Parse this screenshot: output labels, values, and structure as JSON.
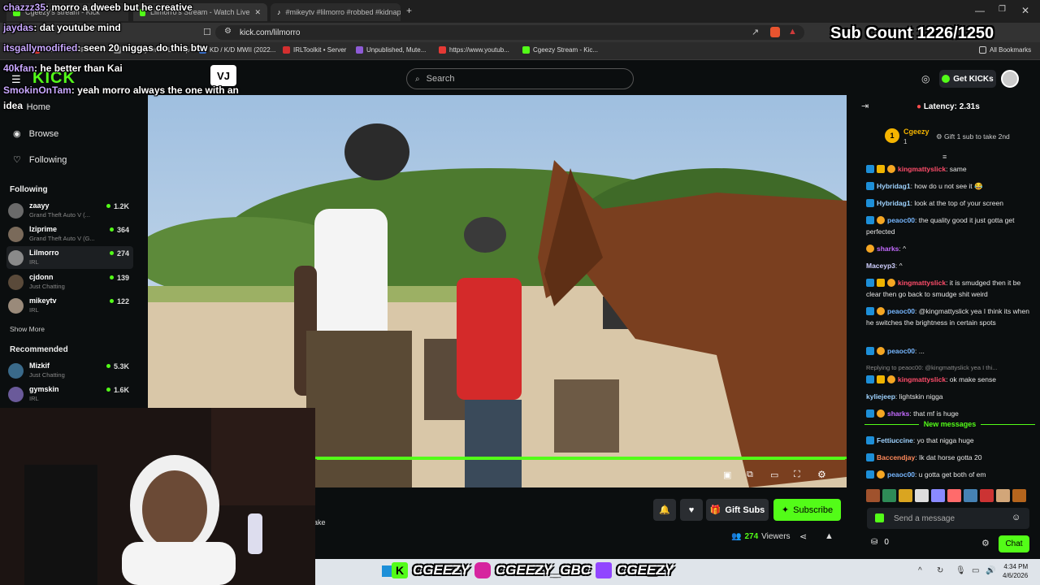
{
  "browser": {
    "tabs": [
      {
        "label": "Cgeezy's stream - Kick"
      },
      {
        "label": "Lilmorro's Stream - Watch Live"
      },
      {
        "label": "#mikeytv #lilmorro #robbed #kidnap"
      }
    ],
    "url": "kick.com/lilmorro",
    "bookmarks": [
      {
        "label": "Youtube to MP3 Conv",
        "color": "#e53935"
      },
      {
        "label": "Delivery Order Lookup",
        "color": "#888888"
      },
      {
        "label": "KD / K/D MWII (2022...",
        "color": "#3b73d1"
      },
      {
        "label": "IRLToolkit • Server",
        "color": "#d32f2f"
      },
      {
        "label": "Unpublished, Mute...",
        "color": "#8e5bd6"
      },
      {
        "label": "https://www.youtub...",
        "color": "#e53935"
      },
      {
        "label": "Cgeezy Stream - Kic...",
        "color": "#53fc18"
      }
    ],
    "all_bookmarks": "All Bookmarks"
  },
  "kick": {
    "search_placeholder": "Search",
    "get_kicks": "Get KICKs",
    "nav": [
      {
        "label": "Home",
        "icon": "home-icon"
      },
      {
        "label": "Browse",
        "icon": "compass-icon"
      },
      {
        "label": "Following",
        "icon": "heart-icon"
      }
    ],
    "following_title": "Following",
    "following": [
      {
        "name": "zaayy",
        "game": "Grand Theft Auto V (...",
        "viewers": "1.2K"
      },
      {
        "name": "lziprime",
        "game": "Grand Theft Auto V (G...",
        "viewers": "364"
      },
      {
        "name": "Lilmorro",
        "game": "IRL",
        "viewers": "274"
      },
      {
        "name": "cjdonn",
        "game": "Just Chatting",
        "viewers": "139"
      },
      {
        "name": "mikeytv",
        "game": "IRL",
        "viewers": "122"
      }
    ],
    "show_more": "Show More",
    "recommended_title": "Recommended",
    "recommended": [
      {
        "name": "Mizkif",
        "game": "Just Chatting",
        "viewers": "5.3K"
      },
      {
        "name": "gymskin",
        "game": "IRL",
        "viewers": "1.6K"
      }
    ],
    "stream_title_fragment": "ake",
    "gift_subs": "Gift Subs",
    "subscribe": "Subscribe",
    "viewers_count": "274",
    "viewers_label": "Viewers",
    "latency": "Latency: 2.31s",
    "top_gifter": {
      "name": "Cgeezy",
      "count": "1",
      "rank": "1"
    },
    "gift_cta": "Gift 1 sub to take 2nd",
    "chat": [
      {
        "user": "kingmattyslick",
        "color": "#ff4d6a",
        "text": "same",
        "badges": [
          "verified",
          "crown",
          "emoji"
        ]
      },
      {
        "user": "Hybridag1",
        "color": "#9fd3ff",
        "text": "how do u not see it 😂",
        "badges": [
          "verified"
        ]
      },
      {
        "user": "Hybridag1",
        "color": "#9fd3ff",
        "text": "look at the top of your screen",
        "badges": [
          "verified"
        ]
      },
      {
        "user": "peaoc00",
        "color": "#77b7ff",
        "text": "the quality good it just gotta get perfected",
        "badges": [
          "verified",
          "emoji"
        ]
      },
      {
        "user": "sharks",
        "color": "#c46bff",
        "text": "^",
        "badges": [
          "emoji"
        ]
      },
      {
        "user": "Maceyp3",
        "color": "#d0d0ff",
        "text": "^",
        "badges": []
      },
      {
        "user": "kingmattyslick",
        "color": "#ff4d6a",
        "text": "it is smudged then it be clear then go back to smudge shit weird",
        "badges": [
          "verified",
          "crown",
          "emoji"
        ]
      },
      {
        "user": "peaoc00",
        "color": "#77b7ff",
        "text": "@kingmattyslick yea I think its when he switches the brightness in certain spots",
        "badges": [
          "verified",
          "emoji"
        ]
      },
      {
        "user": "peaoc00",
        "color": "#77b7ff",
        "text": "...",
        "badges": [
          "verified",
          "emoji"
        ]
      },
      {
        "user": "kingmattyslick",
        "color": "#ff4d6a",
        "text": "ok make sense",
        "badges": [
          "verified",
          "crown",
          "emoji"
        ],
        "reply": "Replying to peaoc00: @kingmattyslick yea I thi..."
      },
      {
        "user": "kyliejeep",
        "color": "#9fd3ff",
        "text": "lightskin nigga",
        "badges": []
      },
      {
        "user": "sharks",
        "color": "#c46bff",
        "text": "that mf is huge",
        "badges": [
          "verified",
          "emoji"
        ]
      }
    ],
    "new_messages": "New messages",
    "chat_after": [
      {
        "user": "Fettiuccine",
        "color": "#9fd3ff",
        "text": "yo that nigga huge",
        "badges": [
          "verified"
        ]
      },
      {
        "user": "Baccendjay",
        "color": "#ff8a5b",
        "text": "Ik dat horse gotta 20",
        "badges": [
          "verified"
        ]
      },
      {
        "user": "peaoc00",
        "color": "#77b7ff",
        "text": "u gotta get both of em",
        "badges": [
          "verified",
          "emoji"
        ]
      }
    ],
    "send_placeholder": "Send a message",
    "kicks_balance": "0",
    "chat_button": "Chat"
  },
  "overlay": {
    "sub_count": "Sub Count 1226/1250",
    "chat_overlay": [
      {
        "user": "chazzz35",
        "text": "morro a dweeb but he creative"
      },
      {
        "user": "jaydas",
        "text": "dat youtube mind"
      },
      {
        "user": "itsgallymodified",
        "text": "seen 20 niggas do this btw"
      },
      {
        "user": "40kfan",
        "text": "he better than Kai"
      },
      {
        "user": "SmokinOnTam",
        "text": "yeah morro always the one with an idea"
      }
    ],
    "socials": [
      "CGEEZY",
      "CGEEZY_GBC",
      "CGEEZY"
    ]
  },
  "taskbar": {
    "time": "4:34 PM",
    "date": "4/6/2026"
  },
  "colors": {
    "accent": "#53fc18",
    "bg": "#0b0e0f"
  }
}
